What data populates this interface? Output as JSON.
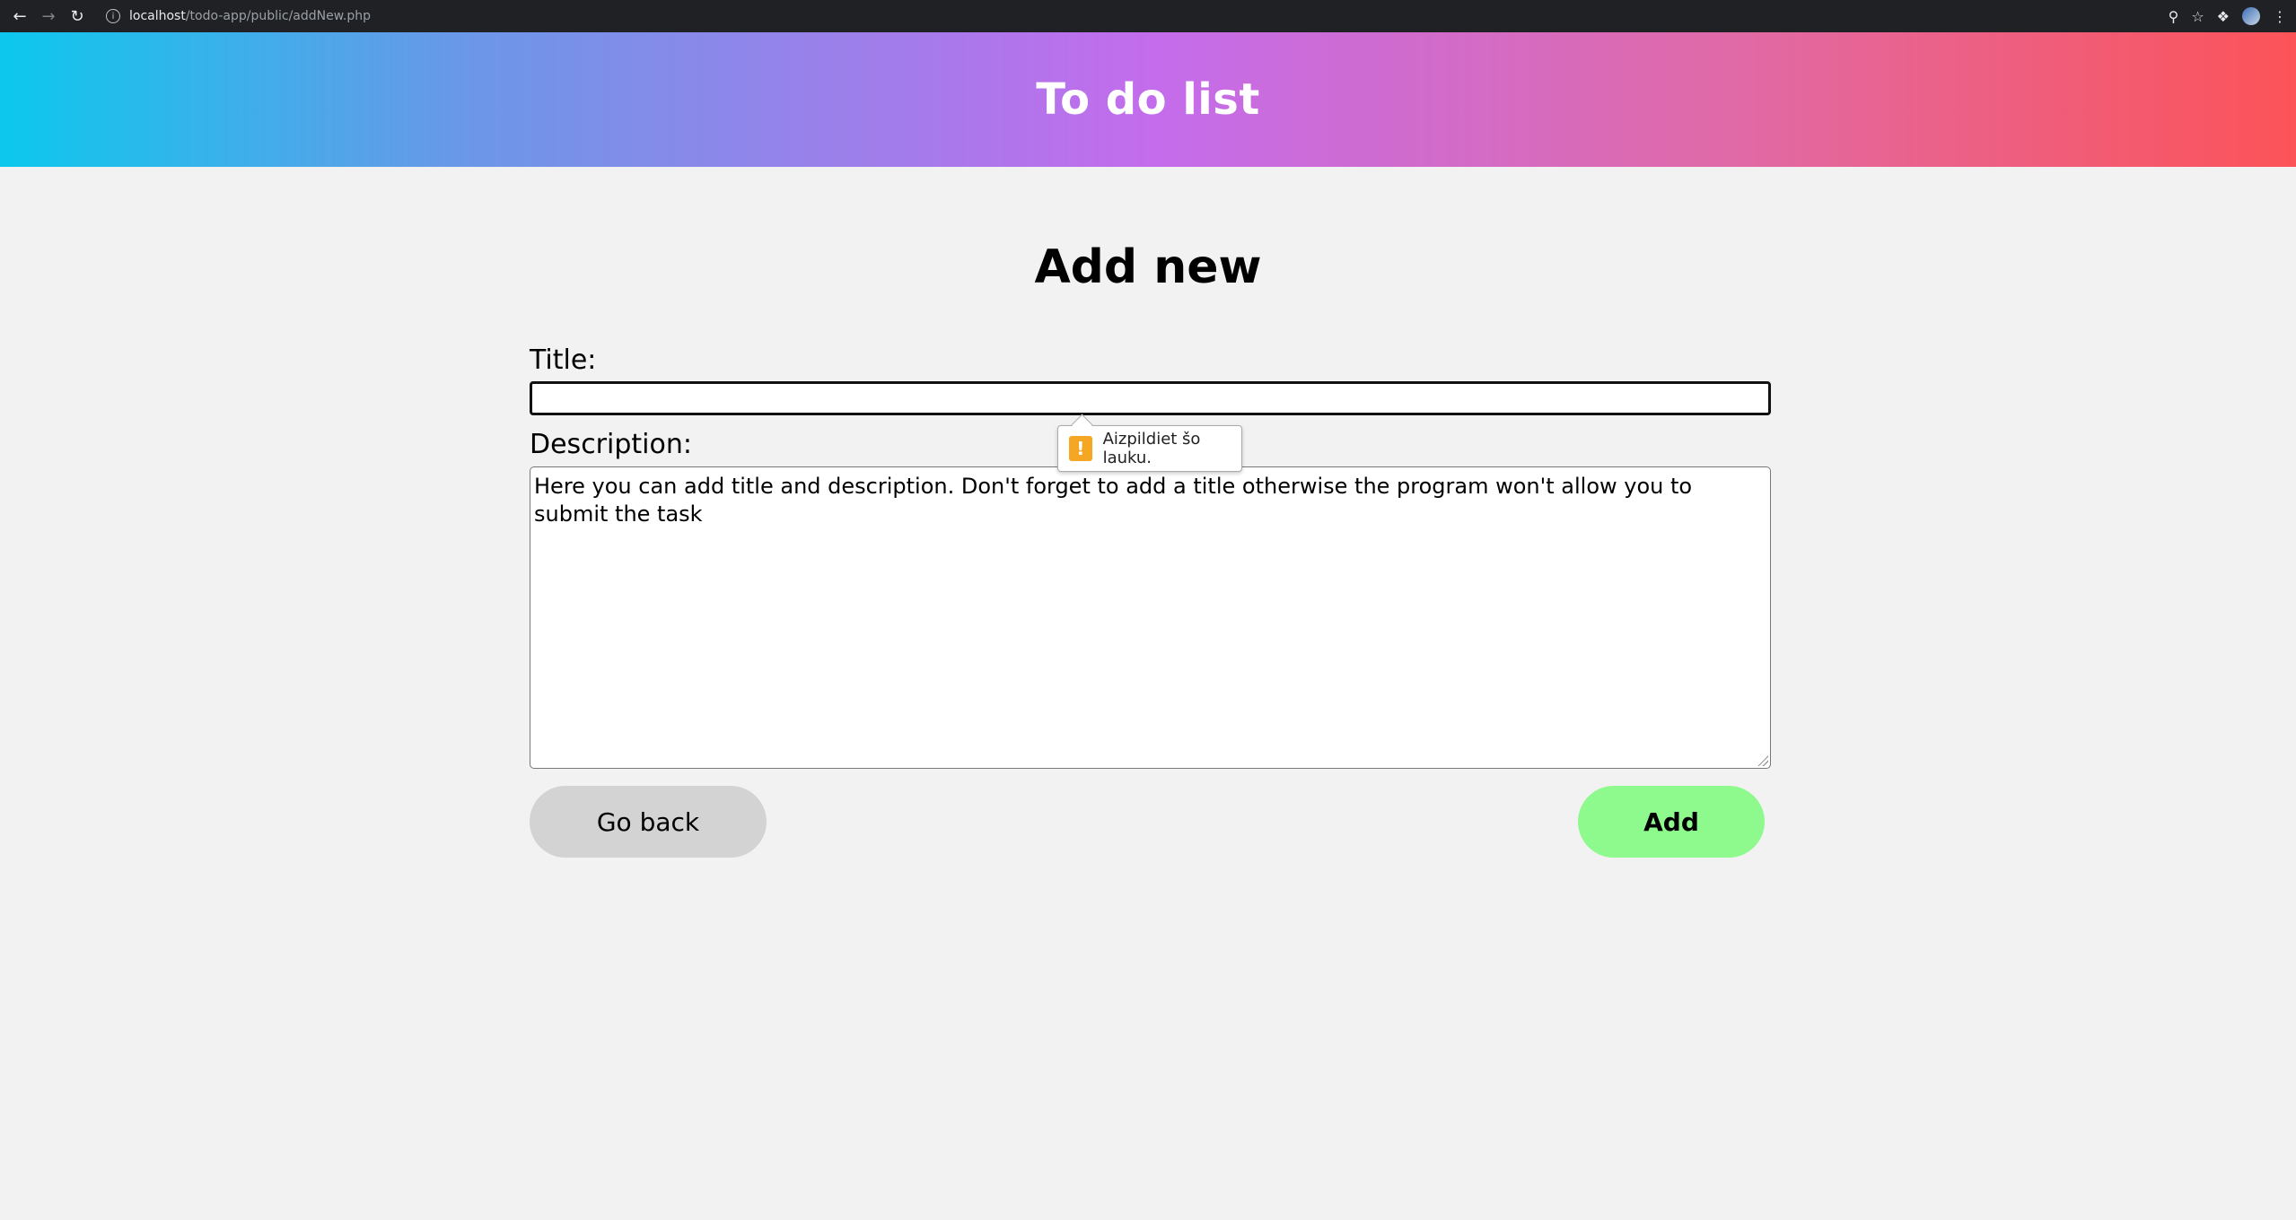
{
  "browser": {
    "url_host": "localhost",
    "url_path": "/todo-app/public/addNew.php"
  },
  "header": {
    "title": "To do list"
  },
  "main": {
    "heading": "Add new",
    "title_label": "Title:",
    "title_value": "",
    "description_label": "Description:",
    "description_value": "Here you can add title and description. Don't forget to add a title otherwise the program won't allow you to submit the task",
    "validation_message": "Aizpildiet šo lauku.",
    "back_button": "Go back",
    "add_button": "Add"
  },
  "colors": {
    "gradient_start": "#0cc8ec",
    "gradient_mid": "#c36cec",
    "gradient_end": "#fc5358",
    "add_button": "#8ef98c",
    "back_button": "#d3d3d3",
    "warning": "#f5a623"
  }
}
